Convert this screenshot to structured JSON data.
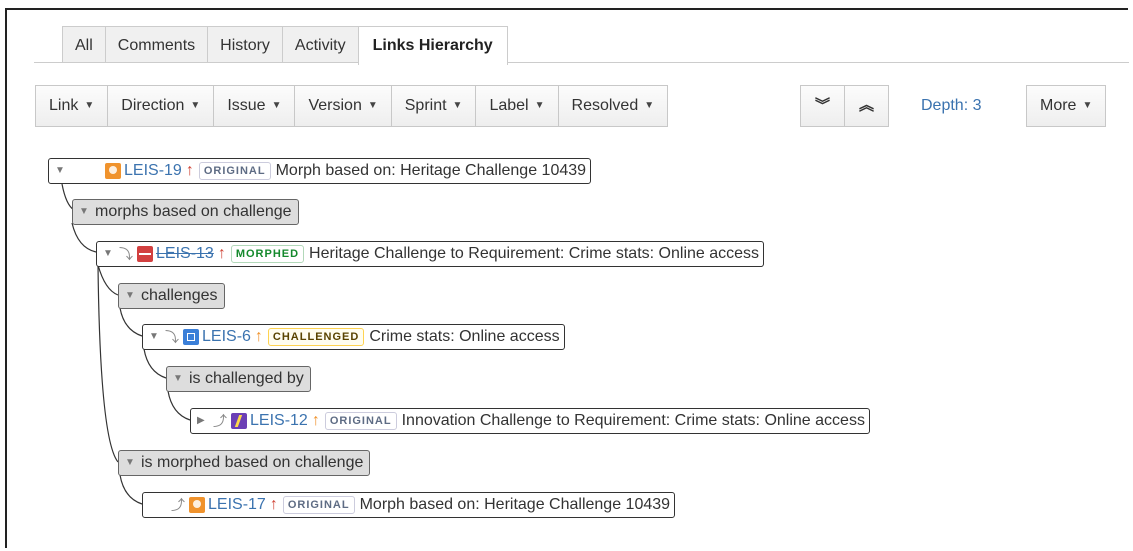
{
  "tabs": [
    {
      "label": "All"
    },
    {
      "label": "Comments"
    },
    {
      "label": "History"
    },
    {
      "label": "Activity"
    },
    {
      "label": "Links Hierarchy",
      "active": true
    }
  ],
  "toolbar": {
    "filters": [
      "Link",
      "Direction",
      "Issue",
      "Version",
      "Sprint",
      "Label",
      "Resolved"
    ],
    "expand_all_icon": "double-chevron-down-icon",
    "collapse_all_icon": "double-chevron-up-icon",
    "depth_label": "Depth: 3",
    "more_label": "More"
  },
  "tree": {
    "root": {
      "key": "LEIS-19",
      "status": "ORIGINAL",
      "summary": "Morph based on: Heritage Challenge 10439",
      "icon": "idea-icon"
    },
    "g1": {
      "label": "morphs based on challenge"
    },
    "n13": {
      "key": "LEIS-13",
      "status": "MORPHED",
      "summary": "Heritage Challenge to Requirement: Crime stats: Online access",
      "icon": "pulse-icon"
    },
    "g2": {
      "label": "challenges"
    },
    "n6": {
      "key": "LEIS-6",
      "status": "CHALLENGED",
      "summary": "Crime stats: Online access",
      "icon": "story-icon"
    },
    "g3": {
      "label": "is challenged by"
    },
    "n12": {
      "key": "LEIS-12",
      "status": "ORIGINAL",
      "summary": "Innovation Challenge to Requirement: Crime stats: Online access",
      "icon": "bolt-icon"
    },
    "g4": {
      "label": "is morphed based on challenge"
    },
    "n17": {
      "key": "LEIS-17",
      "status": "ORIGINAL",
      "summary": "Morph based on: Heritage Challenge 10439",
      "icon": "idea-icon"
    }
  },
  "colors": {
    "link_blue": "#3b73af",
    "priority_red": "#d04437",
    "priority_orange": "#f0932d",
    "morphed_green": "#14892c"
  }
}
